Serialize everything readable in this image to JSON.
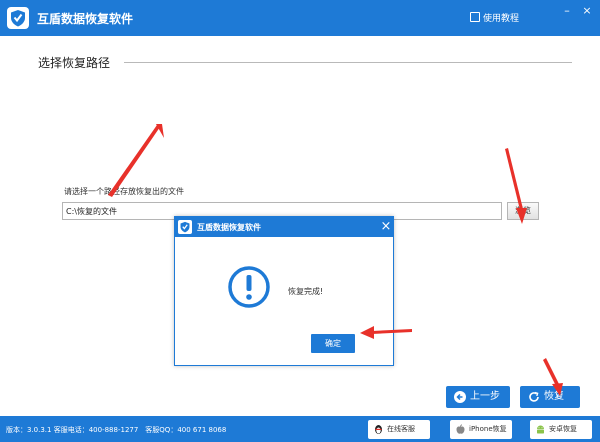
{
  "app": {
    "title": "互盾数据恢复软件",
    "tutorial_label": "使用教程",
    "icons": {
      "logo": "shield-check-logo",
      "tutorial": "book-icon",
      "minimize": "minimize-icon",
      "close": "close-icon"
    },
    "window_controls": {
      "minimize_glyph": "–",
      "close_glyph": "×"
    }
  },
  "page": {
    "section_title": "选择恢复路径",
    "path_label": "请选择一个路径存放恢复出的文件",
    "path_value": "C:\\恢复的文件",
    "browse_label": "浏览"
  },
  "dialog": {
    "title": "互盾数据恢复软件",
    "message": "恢复完成!",
    "ok_label": "确定",
    "close_glyph": "×",
    "icon": "exclamation-circle-icon"
  },
  "nav": {
    "prev_label": "上一步",
    "next_label": "恢复",
    "prev_icon": "arrow-left-icon",
    "next_icon": "refresh-icon"
  },
  "statusbar": {
    "version_text": "版本：3.0.3.1 客服电话：400-888-1277　客服QQ：400 671 8068",
    "kefu_label": "在线客服",
    "iphone_label": "iPhone恢复",
    "android_label": "安卓恢复",
    "icons": {
      "kefu": "qq-penguin-icon",
      "iphone": "apple-icon",
      "android": "android-icon"
    }
  },
  "colors": {
    "brand_blue": "#1e7ad6",
    "annotation_red": "#e8312a"
  }
}
